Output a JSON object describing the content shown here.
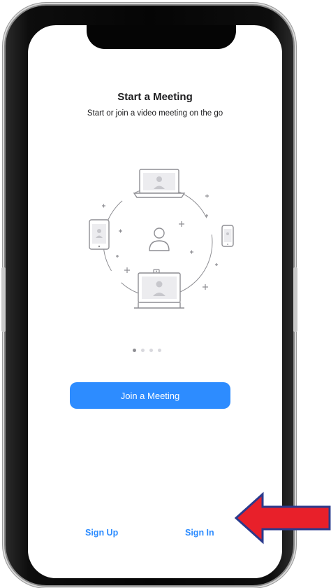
{
  "screen": {
    "title": "Start a Meeting",
    "subtitle": "Start or join a video meeting on the go"
  },
  "illustration": {
    "icons": [
      "laptop-icon",
      "tablet-icon",
      "phone-icon",
      "user-icon",
      "conference-display-icon",
      "sparkle-icon"
    ]
  },
  "pager": {
    "total": 4,
    "active_index": 0
  },
  "actions": {
    "join_label": "Join a Meeting",
    "signup_label": "Sign Up",
    "signin_label": "Sign In"
  },
  "annotation": {
    "arrow_color": "#e8202a",
    "arrow_outline": "#2a3a8c",
    "points_to": "sign-in-link"
  },
  "colors": {
    "accent": "#2d8cff",
    "text": "#1c1c1e",
    "icon_stroke": "#8e8e93"
  }
}
